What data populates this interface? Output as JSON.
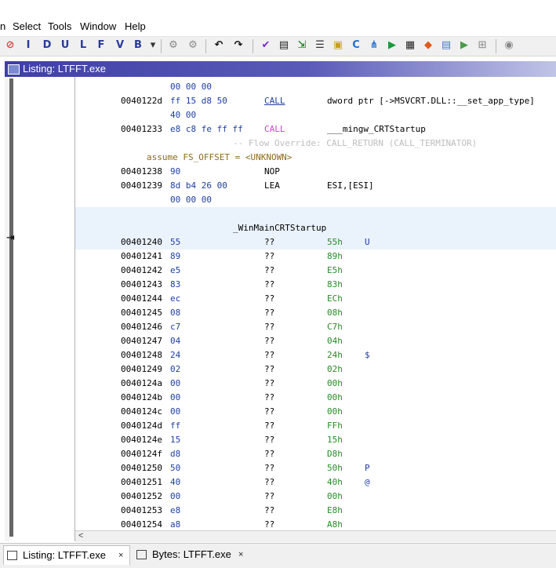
{
  "menu": [
    "n",
    "Select",
    "Tools",
    "Window",
    "Help"
  ],
  "toolbar": {
    "buttons": [
      {
        "name": "circle-stop-icon",
        "glyph": "⊘",
        "color": "#d44"
      },
      {
        "name": "instruction-i-icon",
        "glyph": "I",
        "color": "#2a3a9a"
      },
      {
        "name": "data-d-icon",
        "glyph": "D",
        "color": "#2a3a9a"
      },
      {
        "name": "undefined-u-icon",
        "glyph": "U",
        "color": "#2a3a9a"
      },
      {
        "name": "label-l-icon",
        "glyph": "L",
        "color": "#2a3a9a"
      },
      {
        "name": "function-f-icon",
        "glyph": "F",
        "color": "#2a3a9a"
      },
      {
        "name": "v-icon",
        "glyph": "V",
        "color": "#2a3a9a"
      },
      {
        "name": "b-icon",
        "glyph": "B",
        "color": "#2a3a9a"
      },
      {
        "name": "dropdown-icon",
        "glyph": "▾",
        "color": "#333"
      },
      {
        "name": "gear-grey-icon",
        "glyph": "⚙",
        "color": "#888"
      },
      {
        "name": "gear-grey2-icon",
        "glyph": "⚙",
        "color": "#888"
      },
      {
        "name": "undo-icon",
        "glyph": "↶",
        "color": "#111"
      },
      {
        "name": "redo-icon",
        "glyph": "↷",
        "color": "#111"
      },
      {
        "name": "check-icon",
        "glyph": "✔",
        "color": "#7a2bd0"
      },
      {
        "name": "bytes-icon",
        "glyph": "▤",
        "color": "#222"
      },
      {
        "name": "export-icon",
        "glyph": "⇲",
        "color": "#2a8a2a"
      },
      {
        "name": "list-icon",
        "glyph": "☰",
        "color": "#333"
      },
      {
        "name": "data-types-icon",
        "glyph": "▣",
        "color": "#c8a020"
      },
      {
        "name": "cf-icon",
        "glyph": "C",
        "color": "#1f6fd0"
      },
      {
        "name": "tree-icon",
        "glyph": "⋔",
        "color": "#1f6fd0"
      },
      {
        "name": "play-icon",
        "glyph": "▶",
        "color": "#1a9a3a"
      },
      {
        "name": "chip-icon",
        "glyph": "▦",
        "color": "#222"
      },
      {
        "name": "diamond-icon",
        "glyph": "◆",
        "color": "#e05a1a"
      },
      {
        "name": "table-icon",
        "glyph": "▤",
        "color": "#4a7ad0"
      },
      {
        "name": "script-icon",
        "glyph": "▶",
        "color": "#4a9a4a"
      },
      {
        "name": "network-icon",
        "glyph": "⊞",
        "color": "#999"
      },
      {
        "name": "comment-icon",
        "glyph": "◉",
        "color": "#888"
      }
    ]
  },
  "window": {
    "title": "Listing:  LTFFT.exe"
  },
  "listing": {
    "rows": [
      {
        "addr": "",
        "bytes": "00 00 00",
        "mnem": "",
        "mnem_class": "",
        "oper": ""
      },
      {
        "addr": "0040122d",
        "bytes": "ff 15 d8 50",
        "mnem": "CALL",
        "mnem_class": "call",
        "oper": "dword ptr [->MSVCRT.DLL::__set_app_type]"
      },
      {
        "addr": "",
        "bytes": "40 00",
        "mnem": "",
        "mnem_class": "",
        "oper": ""
      },
      {
        "addr": "00401233",
        "bytes": "e8 c8 fe ff ff",
        "mnem": "CALL",
        "mnem_class": "callr",
        "oper": "___mingw_CRTStartup"
      },
      {
        "flow": "-- Flow Override: CALL_RETURN (CALL_TERMINATOR)"
      },
      {
        "assume": "assume FS_OFFSET = <UNKNOWN>"
      },
      {
        "addr": "00401238",
        "bytes": "90",
        "mnem": "NOP",
        "mnem_class": "nop",
        "oper": ""
      },
      {
        "addr": "00401239",
        "bytes": "8d b4 26 00",
        "mnem": "LEA",
        "mnem_class": "lea",
        "oper": "ESI,[ESI]"
      },
      {
        "addr": "",
        "bytes": "00 00 00",
        "mnem": "",
        "mnem_class": "",
        "oper": ""
      },
      {
        "blank": true
      },
      {
        "label": "_WinMainCRTStartup"
      },
      {
        "addr": "00401240",
        "bytes": "55",
        "mnem": "??",
        "mnem_class": "q",
        "oper": "55h",
        "chr": "U"
      },
      {
        "addr": "00401241",
        "bytes": "89",
        "mnem": "??",
        "mnem_class": "q",
        "oper": "89h",
        "chr": ""
      },
      {
        "addr": "00401242",
        "bytes": "e5",
        "mnem": "??",
        "mnem_class": "q",
        "oper": "E5h",
        "chr": ""
      },
      {
        "addr": "00401243",
        "bytes": "83",
        "mnem": "??",
        "mnem_class": "q",
        "oper": "83h",
        "chr": ""
      },
      {
        "addr": "00401244",
        "bytes": "ec",
        "mnem": "??",
        "mnem_class": "q",
        "oper": "ECh",
        "chr": ""
      },
      {
        "addr": "00401245",
        "bytes": "08",
        "mnem": "??",
        "mnem_class": "q",
        "oper": "08h",
        "chr": ""
      },
      {
        "addr": "00401246",
        "bytes": "c7",
        "mnem": "??",
        "mnem_class": "q",
        "oper": "C7h",
        "chr": ""
      },
      {
        "addr": "00401247",
        "bytes": "04",
        "mnem": "??",
        "mnem_class": "q",
        "oper": "04h",
        "chr": ""
      },
      {
        "addr": "00401248",
        "bytes": "24",
        "mnem": "??",
        "mnem_class": "q",
        "oper": "24h",
        "chr": "$"
      },
      {
        "addr": "00401249",
        "bytes": "02",
        "mnem": "??",
        "mnem_class": "q",
        "oper": "02h",
        "chr": ""
      },
      {
        "addr": "0040124a",
        "bytes": "00",
        "mnem": "??",
        "mnem_class": "q",
        "oper": "00h",
        "chr": ""
      },
      {
        "addr": "0040124b",
        "bytes": "00",
        "mnem": "??",
        "mnem_class": "q",
        "oper": "00h",
        "chr": ""
      },
      {
        "addr": "0040124c",
        "bytes": "00",
        "mnem": "??",
        "mnem_class": "q",
        "oper": "00h",
        "chr": ""
      },
      {
        "addr": "0040124d",
        "bytes": "ff",
        "mnem": "??",
        "mnem_class": "q",
        "oper": "FFh",
        "chr": ""
      },
      {
        "addr": "0040124e",
        "bytes": "15",
        "mnem": "??",
        "mnem_class": "q",
        "oper": "15h",
        "chr": ""
      },
      {
        "addr": "0040124f",
        "bytes": "d8",
        "mnem": "??",
        "mnem_class": "q",
        "oper": "D8h",
        "chr": ""
      },
      {
        "addr": "00401250",
        "bytes": "50",
        "mnem": "??",
        "mnem_class": "q",
        "oper": "50h",
        "chr": "P"
      },
      {
        "addr": "00401251",
        "bytes": "40",
        "mnem": "??",
        "mnem_class": "q",
        "oper": "40h",
        "chr": "@"
      },
      {
        "addr": "00401252",
        "bytes": "00",
        "mnem": "??",
        "mnem_class": "q",
        "oper": "00h",
        "chr": ""
      },
      {
        "addr": "00401253",
        "bytes": "e8",
        "mnem": "??",
        "mnem_class": "q",
        "oper": "E8h",
        "chr": ""
      },
      {
        "addr": "00401254",
        "bytes": "a8",
        "mnem": "??",
        "mnem_class": "q",
        "oper": "A8h",
        "chr": ""
      }
    ]
  },
  "tabs": [
    {
      "label": "Listing:  LTFFT.exe",
      "close": "×",
      "active": true
    },
    {
      "label": "Bytes: LTFFT.exe",
      "close": "×",
      "active": false
    }
  ]
}
